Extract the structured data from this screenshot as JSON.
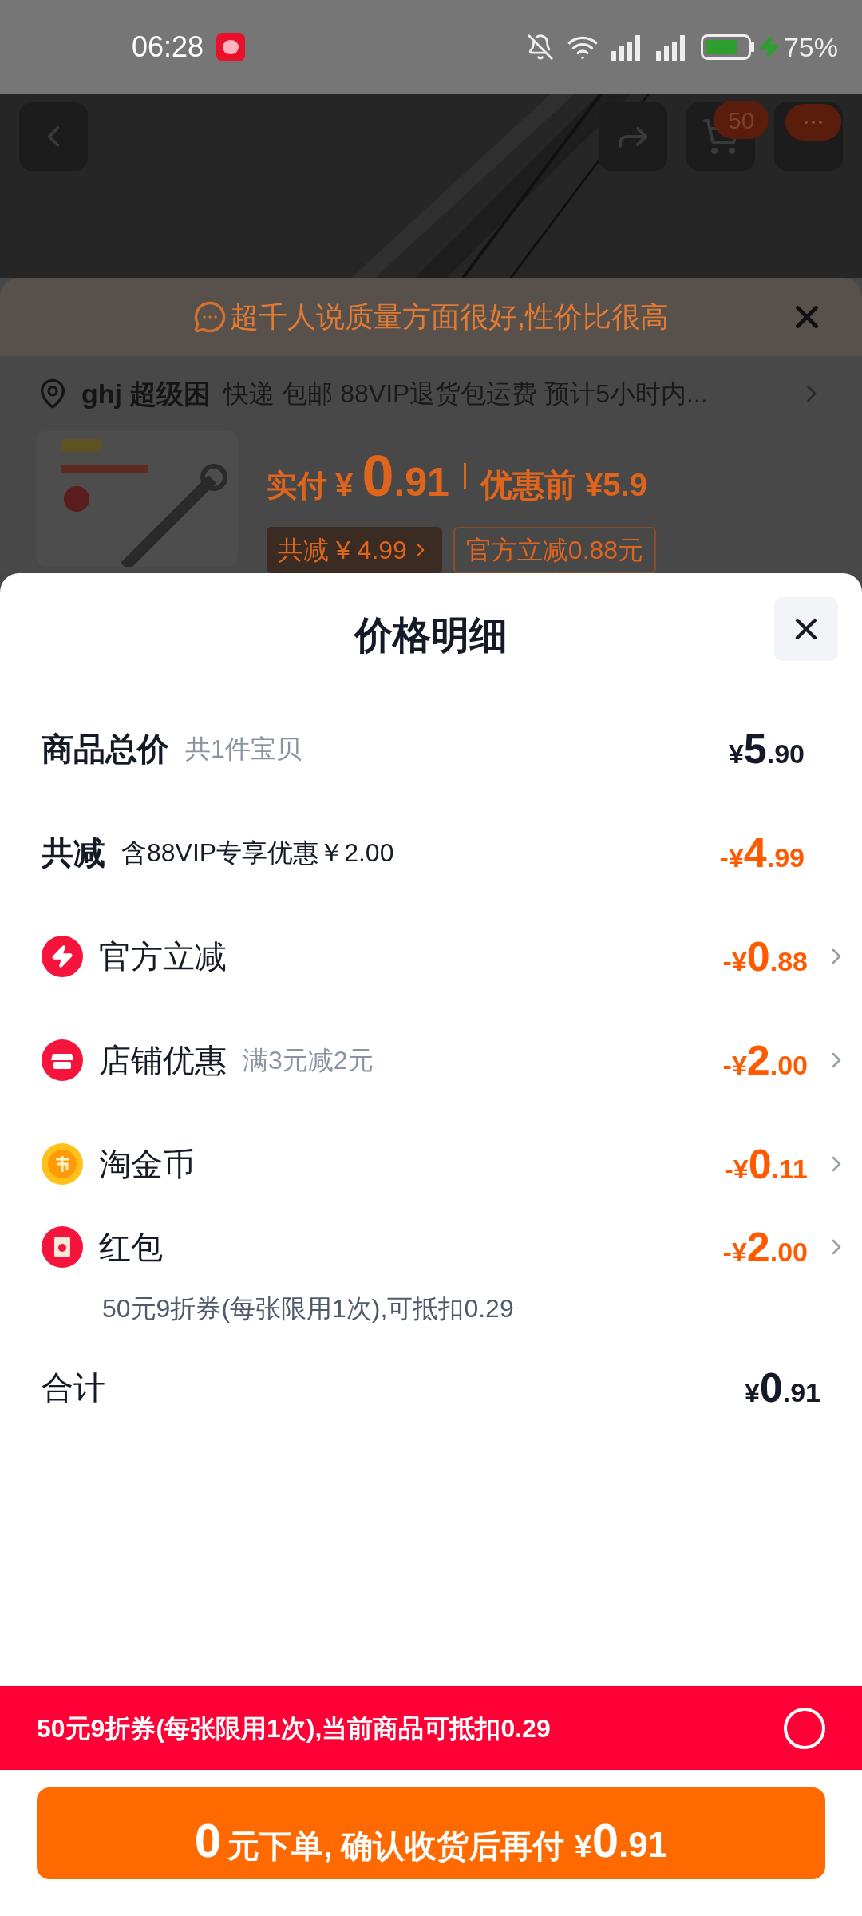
{
  "status_bar": {
    "time": "06:28",
    "battery": "75%"
  },
  "nav": {
    "cart_badge": "50"
  },
  "tip": {
    "text": "超千人说质量方面很好,性价比很高"
  },
  "address": {
    "name": "ghj 超级困",
    "detail": "快递 包邮 88VIP退货包运费 预计5小时内..."
  },
  "product": {
    "paid_label": "实付",
    "currency": "¥",
    "major": "0",
    "minor": ".91",
    "before": "优惠前 ¥5.9",
    "tags": [
      {
        "text": "共减 ¥ 4.99",
        "chevron": true
      },
      {
        "text": "官方立减0.88元",
        "chevron": false
      }
    ]
  },
  "modal": {
    "title": "价格明细",
    "rows": [
      {
        "kind": "price",
        "label": "商品总价",
        "note": "共1件宝贝",
        "prefix": "¥",
        "major": "5",
        "minor": ".90",
        "chevron": false
      },
      {
        "kind": "discount",
        "label": "共减",
        "note": "含88VIP专享优惠￥2.00",
        "prefix": "-¥",
        "major": "4",
        "minor": ".99",
        "chevron": false
      },
      {
        "kind": "bolt",
        "label": "官方立减",
        "prefix": "-¥",
        "major": "0",
        "minor": ".88",
        "chevron": true
      },
      {
        "kind": "shop",
        "label": "店铺优惠",
        "note": "满3元减2元",
        "prefix": "-¥",
        "major": "2",
        "minor": ".00",
        "chevron": true
      },
      {
        "kind": "coin",
        "label": "淘金币",
        "prefix": "-¥",
        "major": "0",
        "minor": ".11",
        "chevron": true
      },
      {
        "kind": "packet",
        "label": "红包",
        "sub": "50元9折券(每张限用1次),可抵扣0.29",
        "prefix": "-¥",
        "major": "2",
        "minor": ".00",
        "chevron": true
      }
    ],
    "total": {
      "label": "合计",
      "prefix": "¥",
      "major": "0",
      "minor": ".91"
    }
  },
  "coupon_bar": {
    "text": "50元9折券(每张限用1次),当前商品可抵扣0.29",
    "selected": false
  },
  "order_button": {
    "lead": "0",
    "text": "元下单, 确认收货后再付",
    "prefix": "¥",
    "major": "0",
    "minor": ".91"
  }
}
